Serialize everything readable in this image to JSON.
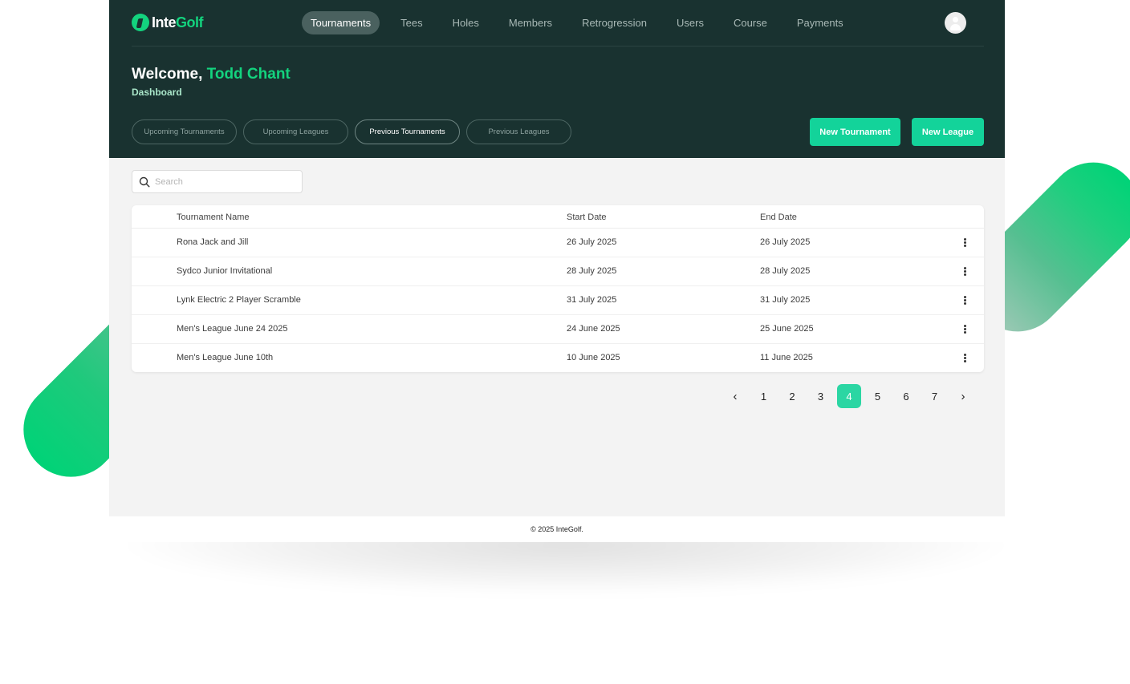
{
  "brand": {
    "part1": "Inte",
    "part2": "Golf",
    "accent": "#13d37e",
    "header_bg": "#193230"
  },
  "nav": [
    {
      "label": "Tournaments",
      "active": true
    },
    {
      "label": "Tees"
    },
    {
      "label": "Holes"
    },
    {
      "label": "Members"
    },
    {
      "label": "Retrogression"
    },
    {
      "label": "Users"
    },
    {
      "label": "Course"
    },
    {
      "label": "Payments"
    }
  ],
  "header": {
    "welcome": "Welcome,",
    "user_name": "Todd Chant",
    "subtitle": "Dashboard"
  },
  "tabs": [
    {
      "label": "Upcoming Tournaments"
    },
    {
      "label": "Upcoming Leagues"
    },
    {
      "label": "Previous Tournaments",
      "active": true
    },
    {
      "label": "Previous Leagues"
    }
  ],
  "actions": {
    "new_tournament": "New Tournament",
    "new_league": "New League"
  },
  "search": {
    "placeholder": "Search",
    "icon": "search-icon"
  },
  "table": {
    "columns": [
      "Tournament Name",
      "Start Date",
      "End Date"
    ],
    "rows": [
      {
        "name": "Rona Jack and Jill",
        "start": "26 July 2025",
        "end": "26 July 2025"
      },
      {
        "name": "Sydco Junior Invitational",
        "start": "28 July 2025",
        "end": "28 July 2025"
      },
      {
        "name": "Lynk Electric 2 Player Scramble",
        "start": "31 July 2025",
        "end": "31 July 2025"
      },
      {
        "name": "Men's League June 24 2025",
        "start": "24 June 2025",
        "end": "25 June 2025"
      },
      {
        "name": "Men's League June 10th",
        "start": "10 June 2025",
        "end": "11 June 2025"
      }
    ],
    "row_menu_icon": "kebab-menu-icon"
  },
  "pagination": {
    "prev": "‹",
    "next": "›",
    "pages": [
      "1",
      "2",
      "3",
      "4",
      "5",
      "6",
      "7"
    ],
    "current": "4"
  },
  "footer": {
    "text": "© 2025 InteGolf."
  }
}
